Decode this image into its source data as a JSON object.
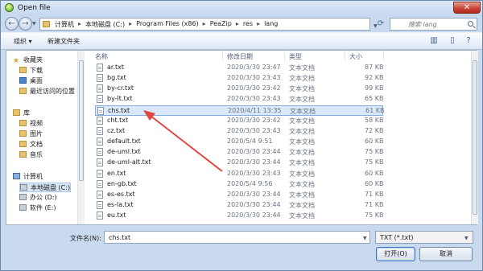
{
  "window": {
    "title": "Open file",
    "close_label": "✕"
  },
  "nav": {
    "back_label": "←",
    "forward_label": "→",
    "breadcrumb": [
      "计算机",
      "本地磁盘 (C:)",
      "Program Files (x86)",
      "PeaZip",
      "res",
      "lang"
    ],
    "search_placeholder": "搜索 lang",
    "refresh_label": "⟳"
  },
  "toolbar": {
    "organize_label": "组织 ▾",
    "new_folder_label": "新建文件夹",
    "view_icon": "▥",
    "pane_icon": "▯",
    "help_icon": "?"
  },
  "sidebar": {
    "favorites_label": "收藏夹",
    "favorites": [
      {
        "label": "下载",
        "icon": "folder-icon"
      },
      {
        "label": "桌面",
        "icon": "blue-icon"
      },
      {
        "label": "最近访问的位置",
        "icon": "folder-icon"
      }
    ],
    "library_label": "库",
    "library": [
      {
        "label": "视频",
        "icon": "folder-icon"
      },
      {
        "label": "图片",
        "icon": "folder-icon"
      },
      {
        "label": "文档",
        "icon": "folder-icon"
      },
      {
        "label": "音乐",
        "icon": "folder-icon"
      }
    ],
    "computer_label": "计算机",
    "computer": [
      {
        "label": "本地磁盘 (C:)",
        "icon": "drive-icon",
        "selected": true
      },
      {
        "label": "办公 (D:)",
        "icon": "drive-icon"
      },
      {
        "label": "软件 (E:)",
        "icon": "drive-icon"
      }
    ]
  },
  "table": {
    "columns": [
      "名称",
      "修改日期",
      "类型",
      "大小"
    ],
    "rows": [
      {
        "name": "ar.txt",
        "date": "2020/3/30 23:47",
        "type": "文本文档",
        "size": "87 KB"
      },
      {
        "name": "bg.txt",
        "date": "2020/3/30 23:43",
        "type": "文本文档",
        "size": "92 KB"
      },
      {
        "name": "by-cr.txt",
        "date": "2020/3/30 23:42",
        "type": "文本文档",
        "size": "99 KB"
      },
      {
        "name": "by-lt.txt",
        "date": "2020/3/30 23:43",
        "type": "文本文档",
        "size": "65 KB"
      },
      {
        "name": "chs.txt",
        "date": "2020/4/11 13:35",
        "type": "文本文档",
        "size": "61 KB",
        "selected": true
      },
      {
        "name": "cht.txt",
        "date": "2020/3/30 23:42",
        "type": "文本文档",
        "size": "58 KB"
      },
      {
        "name": "cz.txt",
        "date": "2020/3/30 23:43",
        "type": "文本文档",
        "size": "72 KB"
      },
      {
        "name": "default.txt",
        "date": "2020/5/4 9:51",
        "type": "文本文档",
        "size": "60 KB"
      },
      {
        "name": "de-uml.txt",
        "date": "2020/3/30 23:44",
        "type": "文本文档",
        "size": "75 KB"
      },
      {
        "name": "de-uml-alt.txt",
        "date": "2020/3/30 23:44",
        "type": "文本文档",
        "size": "75 KB"
      },
      {
        "name": "en.txt",
        "date": "2020/3/30 23:43",
        "type": "文本文档",
        "size": "60 KB"
      },
      {
        "name": "en-gb.txt",
        "date": "2020/5/4 9:56",
        "type": "文本文档",
        "size": "60 KB"
      },
      {
        "name": "es-es.txt",
        "date": "2020/3/30 23:44",
        "type": "文本文档",
        "size": "71 KB"
      },
      {
        "name": "es-la.txt",
        "date": "2020/3/30 23:44",
        "type": "文本文档",
        "size": "71 KB"
      },
      {
        "name": "eu.txt",
        "date": "2020/3/30 23:44",
        "type": "文本文档",
        "size": "75 KB"
      }
    ]
  },
  "footer": {
    "filename_label": "文件名(N):",
    "filename_value": "chs.txt",
    "filter_value": "TXT (*.txt)",
    "open_label": "打开(O)",
    "cancel_label": "取消"
  },
  "annotation": {
    "arrow_color": "#e2473f"
  }
}
